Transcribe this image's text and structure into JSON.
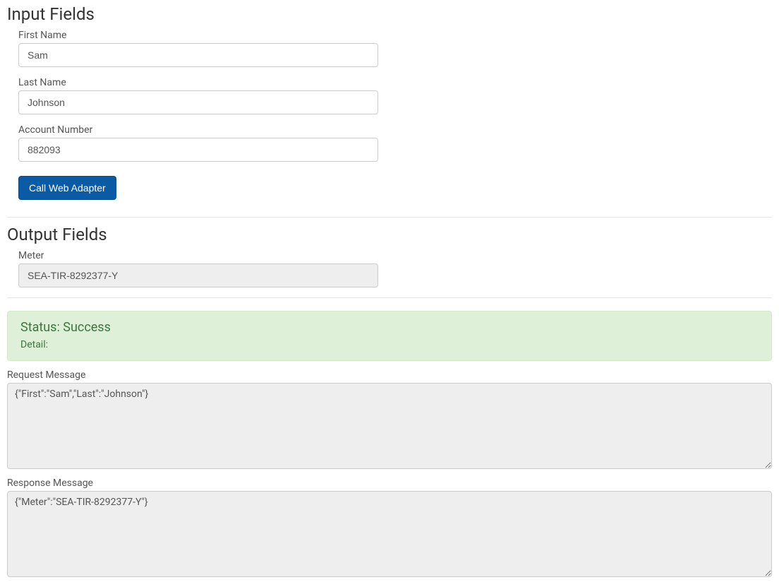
{
  "input_section": {
    "heading": "Input Fields",
    "fields": {
      "first_name": {
        "label": "First Name",
        "value": "Sam"
      },
      "last_name": {
        "label": "Last Name",
        "value": "Johnson"
      },
      "account_number": {
        "label": "Account Number",
        "value": "882093"
      }
    },
    "button_label": "Call Web Adapter"
  },
  "output_section": {
    "heading": "Output Fields",
    "fields": {
      "meter": {
        "label": "Meter",
        "value": "SEA-TIR-8292377-Y"
      }
    }
  },
  "status_panel": {
    "status_label": "Status:",
    "status_value": "Success",
    "detail_label": "Detail:",
    "detail_value": ""
  },
  "request_message": {
    "label": "Request Message",
    "value": "{\"First\":\"Sam\",\"Last\":\"Johnson\"}"
  },
  "response_message": {
    "label": "Response Message",
    "value": "{\"Meter\":\"SEA-TIR-8292377-Y\"}"
  }
}
